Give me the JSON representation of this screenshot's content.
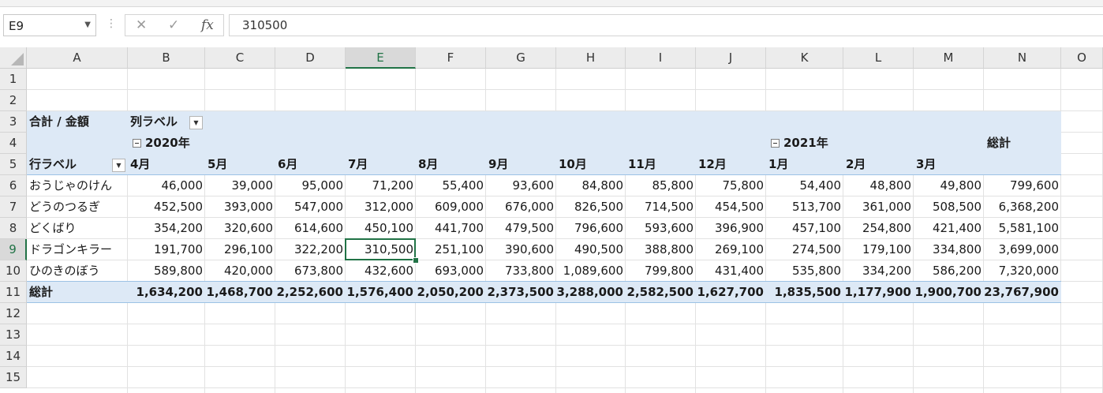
{
  "formula_bar": {
    "name_box": "E9",
    "cancel_symbol": "✕",
    "enter_symbol": "✓",
    "fx_symbol": "fx",
    "content": "310500"
  },
  "columns": [
    "A",
    "B",
    "C",
    "D",
    "E",
    "F",
    "G",
    "H",
    "I",
    "J",
    "K",
    "L",
    "M",
    "N",
    "O"
  ],
  "rows": [
    "1",
    "2",
    "3",
    "4",
    "5",
    "6",
    "7",
    "8",
    "9",
    "10",
    "11",
    "12",
    "13",
    "14",
    "15"
  ],
  "selected_cell": {
    "column": "E",
    "row": "9"
  },
  "pivot": {
    "value_field_label": "合計 / 金額",
    "column_labels_caption": "列ラベル",
    "row_labels_caption": "行ラベル",
    "year_2020": "2020年",
    "year_2021": "2021年",
    "grand_total_header": "総計",
    "months": [
      "4月",
      "5月",
      "6月",
      "7月",
      "8月",
      "9月",
      "10月",
      "11月",
      "12月",
      "1月",
      "2月",
      "3月"
    ],
    "rows": [
      {
        "label": "おうじゃのけん",
        "values": [
          "46,000",
          "39,000",
          "95,000",
          "71,200",
          "55,400",
          "93,600",
          "84,800",
          "85,800",
          "75,800",
          "54,400",
          "48,800",
          "49,800"
        ],
        "total": "799,600"
      },
      {
        "label": "どうのつるぎ",
        "values": [
          "452,500",
          "393,000",
          "547,000",
          "312,000",
          "609,000",
          "676,000",
          "826,500",
          "714,500",
          "454,500",
          "513,700",
          "361,000",
          "508,500"
        ],
        "total": "6,368,200"
      },
      {
        "label": "どくばり",
        "values": [
          "354,200",
          "320,600",
          "614,600",
          "450,100",
          "441,700",
          "479,500",
          "796,600",
          "593,600",
          "396,900",
          "457,100",
          "254,800",
          "421,400"
        ],
        "total": "5,581,100"
      },
      {
        "label": "ドラゴンキラー",
        "values": [
          "191,700",
          "296,100",
          "322,200",
          "310,500",
          "251,100",
          "390,600",
          "490,500",
          "388,800",
          "269,100",
          "274,500",
          "179,100",
          "334,800"
        ],
        "total": "3,699,000"
      },
      {
        "label": "ひのきのぼう",
        "values": [
          "589,800",
          "420,000",
          "673,800",
          "432,600",
          "693,000",
          "733,800",
          "1,089,600",
          "799,800",
          "431,400",
          "535,800",
          "334,200",
          "586,200"
        ],
        "total": "7,320,000"
      }
    ],
    "grand_total": {
      "label": "総計",
      "values": [
        "1,634,200",
        "1,468,700",
        "2,252,600",
        "1,576,400",
        "2,050,200",
        "2,373,500",
        "3,288,000",
        "2,582,500",
        "1,627,700",
        "1,835,500",
        "1,177,900",
        "1,900,700"
      ],
      "total": "23,767,900"
    }
  },
  "colors": {
    "pivot_band": "#dde9f6",
    "selection_green": "#217346",
    "header_gray": "#ececec"
  }
}
